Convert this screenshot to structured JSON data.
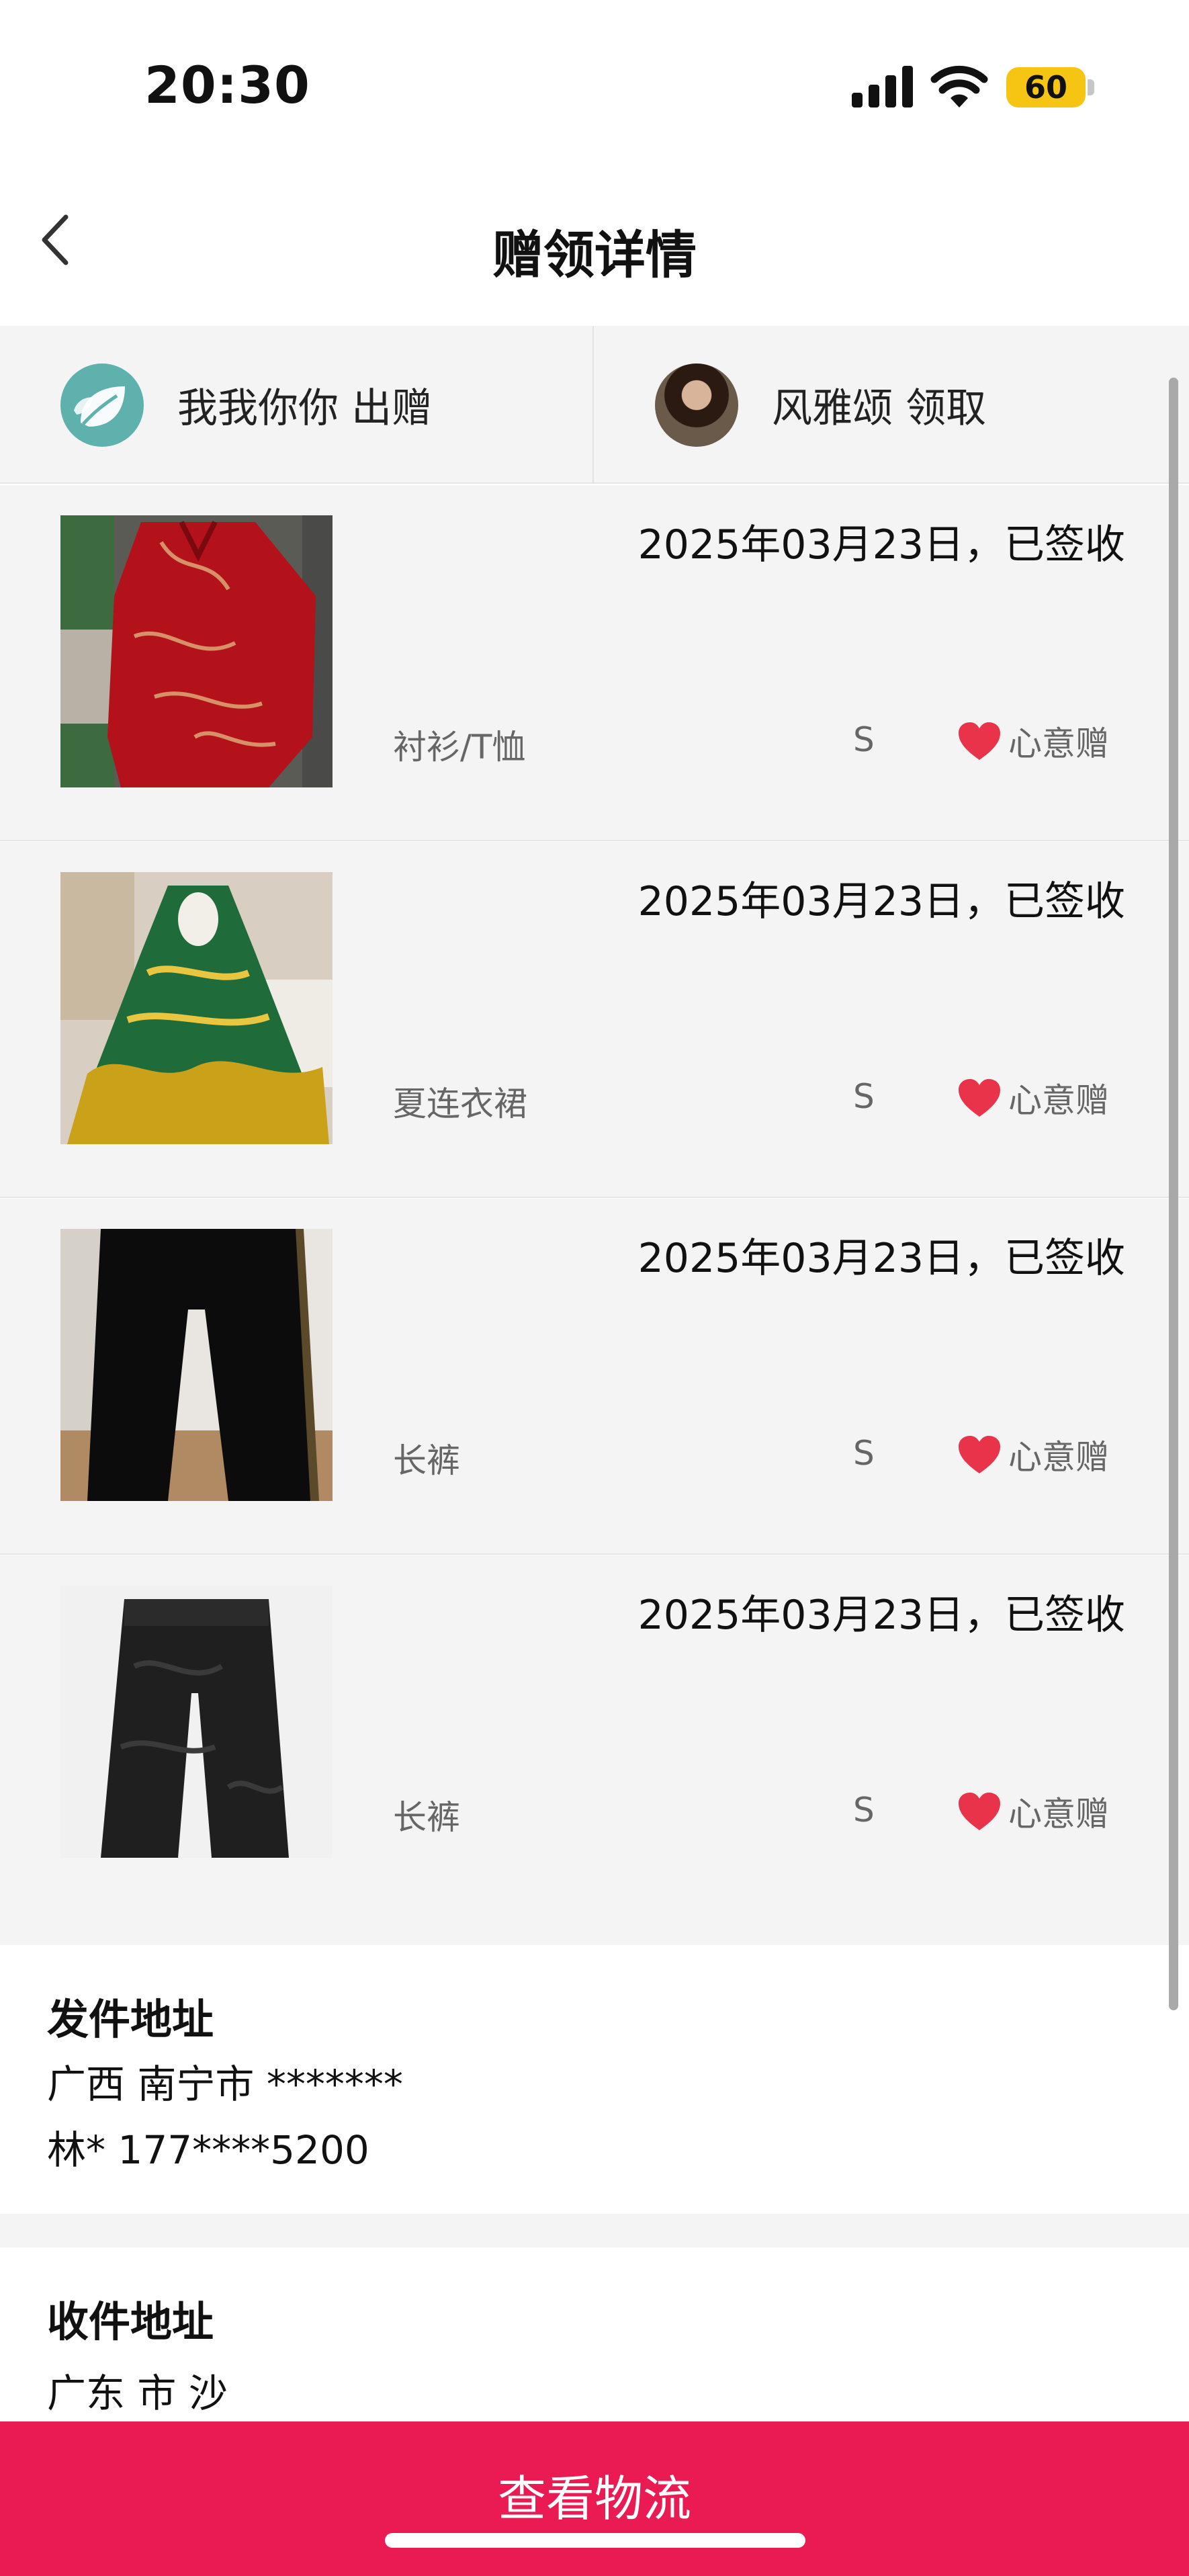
{
  "status_bar": {
    "time": "20:30",
    "battery": "60",
    "battery_color": "#f6c514"
  },
  "header": {
    "title": "赠领详情",
    "back_icon": "chevron-left-icon"
  },
  "parties": {
    "giver": {
      "name": "我我你你 出赠",
      "avatar": "leaf-avatar"
    },
    "receiver": {
      "name": "风雅颂 领取",
      "avatar": "photo-avatar"
    }
  },
  "items": [
    {
      "date": "2025年03月23日，已签收",
      "category": "衬衫/T恤",
      "size": "S",
      "tag": "心意赠",
      "image": "red-dragon-shirt"
    },
    {
      "date": "2025年03月23日，已签收",
      "category": "夏连衣裙",
      "size": "S",
      "tag": "心意赠",
      "image": "green-print-dress"
    },
    {
      "date": "2025年03月23日，已签收",
      "category": "长裤",
      "size": "S",
      "tag": "心意赠",
      "image": "black-velvet-pants"
    },
    {
      "date": "2025年03月23日，已签收",
      "category": "长裤",
      "size": "S",
      "tag": "心意赠",
      "image": "black-jacquard-pants"
    }
  ],
  "sender_address": {
    "title": "发件地址",
    "region": "广西 南宁市 *******",
    "contact": "林* 177****5200"
  },
  "receiver_address": {
    "title": "收件地址",
    "region": "广东 市 沙"
  },
  "footer": {
    "button_label": "查看物流"
  },
  "colors": {
    "accent": "#ea1a52",
    "heart": "#e8334a",
    "background": "#f4f4f4"
  }
}
